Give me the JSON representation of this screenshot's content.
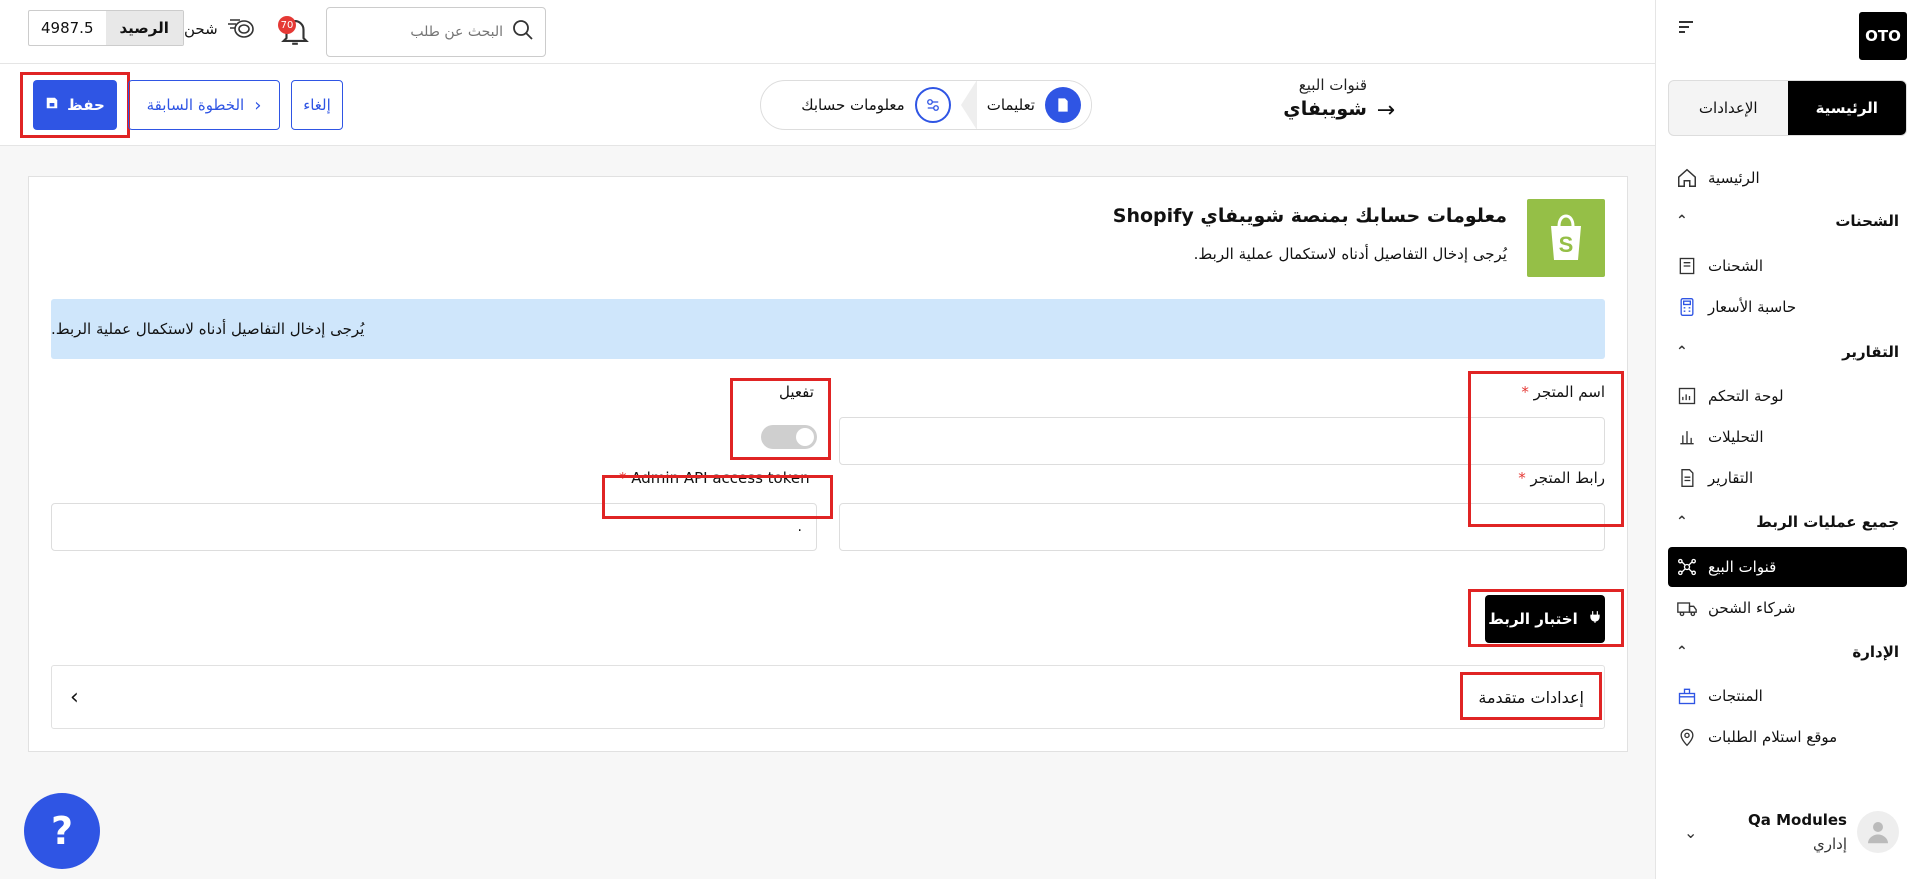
{
  "sidebar": {
    "logo": "OTO",
    "tabs": [
      {
        "label": "الرئيسية",
        "active": true
      },
      {
        "label": "الإعدادات",
        "active": false
      }
    ],
    "home_item": "الرئيسية",
    "sections": [
      {
        "title": "الشحنات",
        "items": [
          "الشحنات",
          "حاسبة الأسعار"
        ]
      },
      {
        "title": "التقارير",
        "items": [
          "لوحة التحكم",
          "التحليلات",
          "التقارير"
        ]
      },
      {
        "title": "جميع عمليات الربط",
        "items": [
          "قنوات البيع",
          "شركاء الشحن"
        ]
      },
      {
        "title": "الإدارة",
        "items": [
          "المنتجات",
          "موقع استلام الطلبات"
        ]
      }
    ],
    "user": {
      "name": "Qa Modules",
      "role": "إداري"
    }
  },
  "topbar": {
    "balance_label": "الرصيد",
    "balance_value": "4987.5",
    "charge_label": "شحن",
    "notifications_count": "70",
    "search_placeholder": "البحث عن طلب"
  },
  "actionbar": {
    "save_label": "حفظ",
    "prev_label": "الخطوة السابقة",
    "cancel_label": "إلغاء",
    "steps": [
      {
        "label": "تعليمات",
        "state": "active"
      },
      {
        "label": "معلومات حسابك",
        "state": "pending"
      }
    ],
    "breadcrumb_parent": "قنوات البيع",
    "breadcrumb_current": "شويبفاي"
  },
  "card": {
    "title": "معلومات حسابك بمنصة شويبفاي Shopify",
    "subtitle": "يُرجى إدخال التفاصيل أدناه لاستكمال عملية الربط.",
    "info_banner": "يُرجى إدخال التفاصيل أدناه لاستكمال عملية الربط.",
    "store_name_label": "اسم المتجر",
    "activation_label": "تفعيل",
    "activation_on": false,
    "store_url_label": "رابط المتجر",
    "token_label": "Admin API access token",
    "required_mark": "*",
    "token_value": ".",
    "test_button": "اختبار الربط",
    "advanced_label": "إعدادات متقدمة"
  },
  "help_label": "?",
  "colors": {
    "accent": "#2f55e4",
    "shopify": "#95bf47",
    "highlight": "#e02424",
    "info_bg": "#cfe6fb"
  }
}
